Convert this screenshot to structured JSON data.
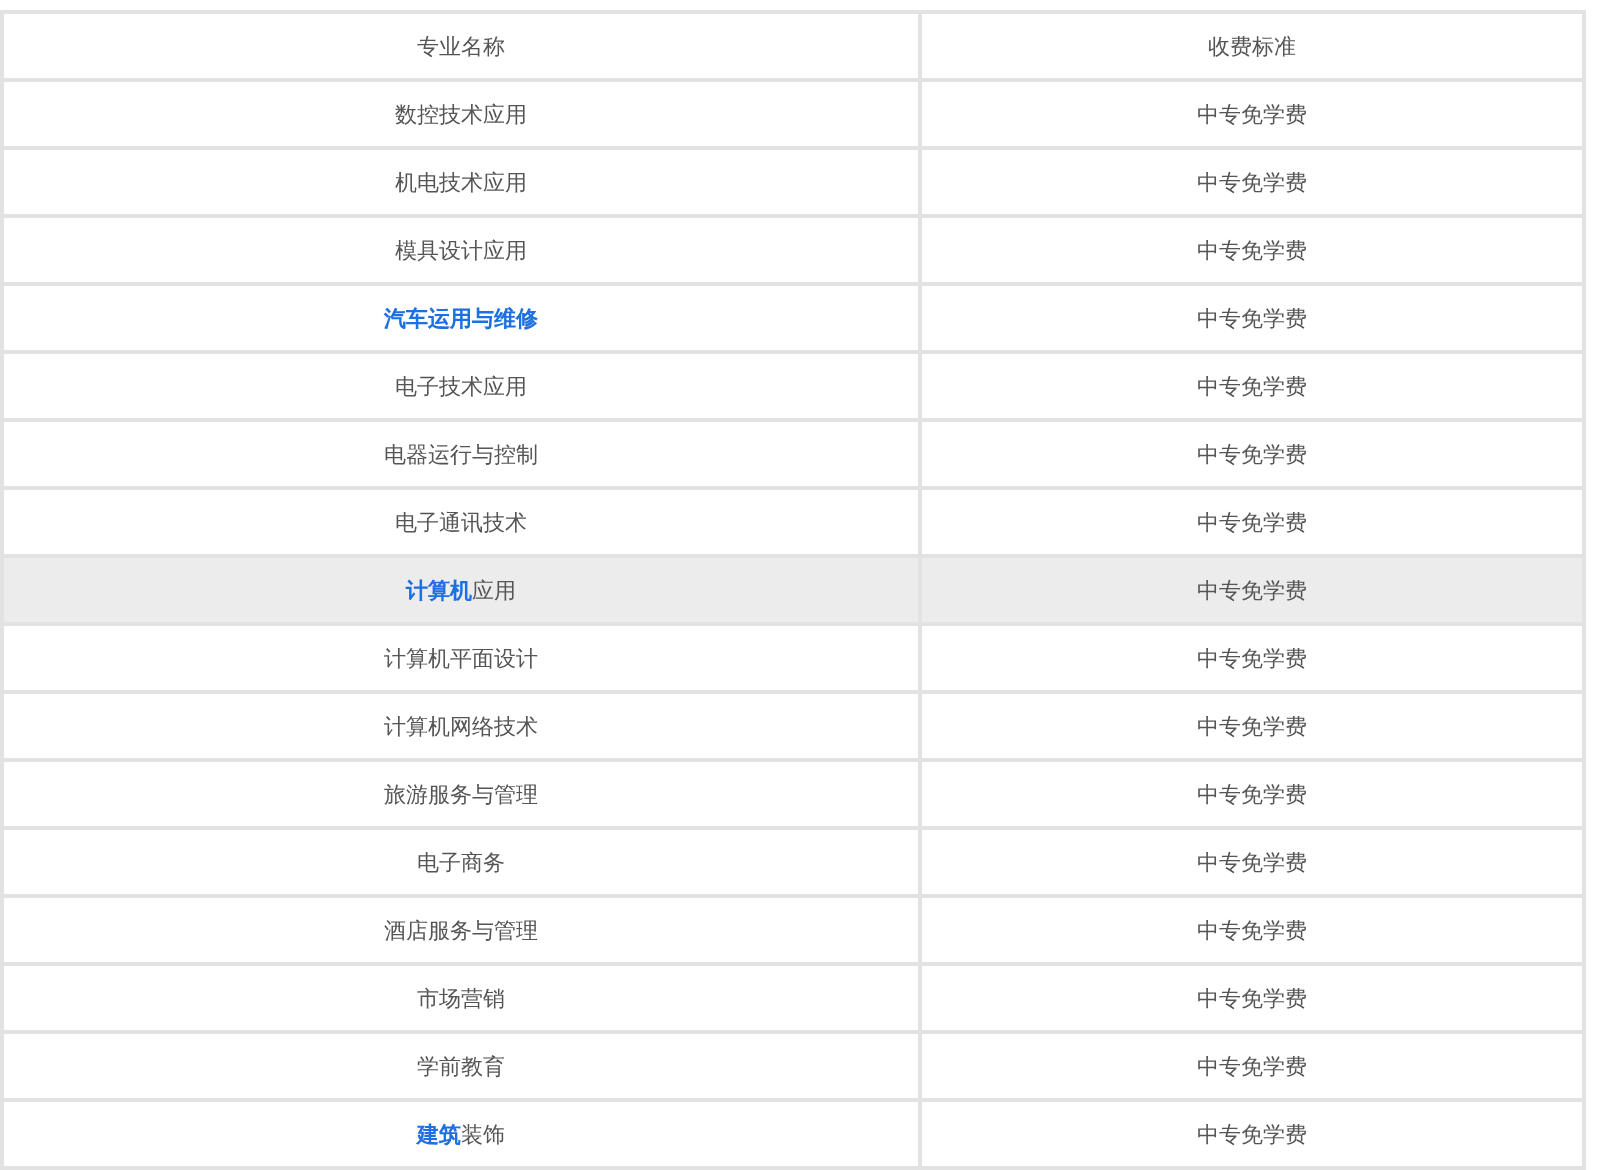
{
  "table": {
    "columns": [
      "专业名称",
      "收费标准"
    ],
    "rows": [
      {
        "name": "数控技术应用",
        "link": false,
        "fee": "中专免学费",
        "selected": false
      },
      {
        "name": "机电技术应用",
        "link": false,
        "fee": "中专免学费",
        "selected": false
      },
      {
        "name": "模具设计应用",
        "link": false,
        "fee": "中专免学费",
        "selected": false
      },
      {
        "name": "汽车运用与维修",
        "link": true,
        "fee": "中专免学费",
        "selected": false
      },
      {
        "name": "电子技术应用",
        "link": false,
        "fee": "中专免学费",
        "selected": false
      },
      {
        "name": "电器运行与控制",
        "link": false,
        "fee": "中专免学费",
        "selected": false
      },
      {
        "name": "电子通讯技术",
        "link": false,
        "fee": "中专免学费",
        "selected": false
      },
      {
        "name": "**计算机**应用",
        "link": false,
        "fee": "中专免学费",
        "selected": true
      },
      {
        "name": "计算机平面设计",
        "link": false,
        "fee": "中专免学费",
        "selected": false
      },
      {
        "name": "计算机网络技术",
        "link": false,
        "fee": "中专免学费",
        "selected": false
      },
      {
        "name": "旅游服务与管理",
        "link": false,
        "fee": "中专免学费",
        "selected": false
      },
      {
        "name": "电子商务",
        "link": false,
        "fee": "中专免学费",
        "selected": false
      },
      {
        "name": "酒店服务与管理",
        "link": false,
        "fee": "中专免学费",
        "selected": false
      },
      {
        "name": "市场营销",
        "link": false,
        "fee": "中专免学费",
        "selected": false
      },
      {
        "name": "学前教育",
        "link": false,
        "fee": "中专免学费",
        "selected": false
      },
      {
        "name": "**建筑**装饰",
        "link": false,
        "fee": "中专免学费",
        "selected": false
      }
    ]
  }
}
